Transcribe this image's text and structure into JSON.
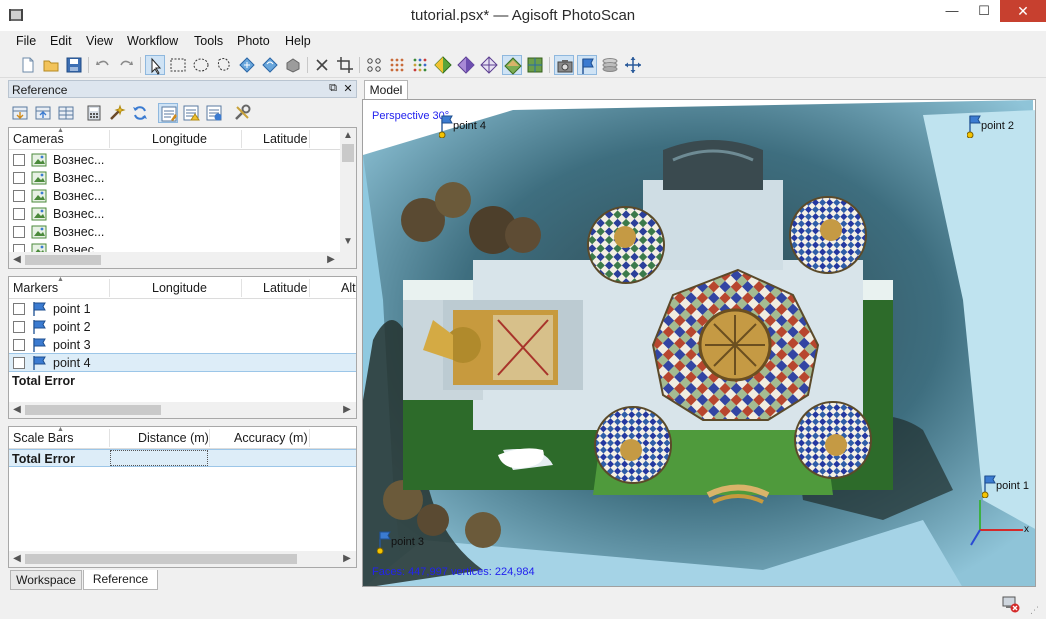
{
  "window": {
    "title": "tutorial.psx* — Agisoft PhotoScan"
  },
  "menu": [
    "File",
    "Edit",
    "View",
    "Workflow",
    "Tools",
    "Photo",
    "Help"
  ],
  "reference_panel": {
    "title": "Reference",
    "cameras": {
      "headers": [
        "Cameras",
        "Longitude",
        "Latitude"
      ],
      "rows": [
        "Вознес...",
        "Вознес...",
        "Вознес...",
        "Вознес...",
        "Вознес...",
        "Вознес..."
      ]
    },
    "markers": {
      "headers": [
        "Markers",
        "Longitude",
        "Latitude",
        "Alt"
      ],
      "rows": [
        "point 1",
        "point 2",
        "point 3",
        "point 4"
      ],
      "total": "Total Error"
    },
    "scalebars": {
      "headers": [
        "Scale Bars",
        "Distance (m)",
        "Accuracy (m)"
      ],
      "total": "Total Error"
    }
  },
  "bottom_tabs": [
    "Workspace",
    "Reference"
  ],
  "model": {
    "tab": "Model",
    "perspective": "Perspective 30°",
    "faces": "Faces: 447,997 vertices: 224,984",
    "markers": [
      "point 4",
      "point 2",
      "point 1",
      "point 3"
    ],
    "axis_x": "x"
  },
  "colors": {
    "accent": "#cfe3f5",
    "selection": "#ddedf8",
    "close": "#c7402f"
  }
}
